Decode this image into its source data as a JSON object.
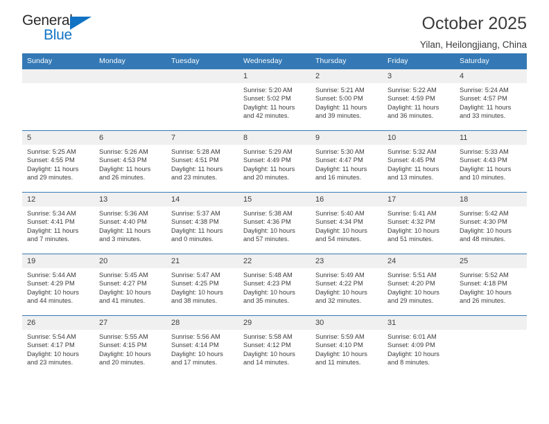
{
  "brand": {
    "name_part1": "General",
    "name_part2": "Blue",
    "accent_color": "#1273c4"
  },
  "header": {
    "title": "October 2025",
    "subtitle": "Yilan, Heilongjiang, China"
  },
  "theme": {
    "header_row_color": "#3479b5",
    "daynum_band_color": "#f0f0f0",
    "text_color": "#3b3b3b"
  },
  "calendar": {
    "weekday_headers": [
      "Sunday",
      "Monday",
      "Tuesday",
      "Wednesday",
      "Thursday",
      "Friday",
      "Saturday"
    ],
    "weeks": [
      [
        {
          "day": "",
          "empty": true
        },
        {
          "day": "",
          "empty": true
        },
        {
          "day": "",
          "empty": true
        },
        {
          "day": "1",
          "sunrise": "Sunrise: 5:20 AM",
          "sunset": "Sunset: 5:02 PM",
          "daylight": "Daylight: 11 hours and 42 minutes."
        },
        {
          "day": "2",
          "sunrise": "Sunrise: 5:21 AM",
          "sunset": "Sunset: 5:00 PM",
          "daylight": "Daylight: 11 hours and 39 minutes."
        },
        {
          "day": "3",
          "sunrise": "Sunrise: 5:22 AM",
          "sunset": "Sunset: 4:59 PM",
          "daylight": "Daylight: 11 hours and 36 minutes."
        },
        {
          "day": "4",
          "sunrise": "Sunrise: 5:24 AM",
          "sunset": "Sunset: 4:57 PM",
          "daylight": "Daylight: 11 hours and 33 minutes."
        }
      ],
      [
        {
          "day": "5",
          "sunrise": "Sunrise: 5:25 AM",
          "sunset": "Sunset: 4:55 PM",
          "daylight": "Daylight: 11 hours and 29 minutes."
        },
        {
          "day": "6",
          "sunrise": "Sunrise: 5:26 AM",
          "sunset": "Sunset: 4:53 PM",
          "daylight": "Daylight: 11 hours and 26 minutes."
        },
        {
          "day": "7",
          "sunrise": "Sunrise: 5:28 AM",
          "sunset": "Sunset: 4:51 PM",
          "daylight": "Daylight: 11 hours and 23 minutes."
        },
        {
          "day": "8",
          "sunrise": "Sunrise: 5:29 AM",
          "sunset": "Sunset: 4:49 PM",
          "daylight": "Daylight: 11 hours and 20 minutes."
        },
        {
          "day": "9",
          "sunrise": "Sunrise: 5:30 AM",
          "sunset": "Sunset: 4:47 PM",
          "daylight": "Daylight: 11 hours and 16 minutes."
        },
        {
          "day": "10",
          "sunrise": "Sunrise: 5:32 AM",
          "sunset": "Sunset: 4:45 PM",
          "daylight": "Daylight: 11 hours and 13 minutes."
        },
        {
          "day": "11",
          "sunrise": "Sunrise: 5:33 AM",
          "sunset": "Sunset: 4:43 PM",
          "daylight": "Daylight: 11 hours and 10 minutes."
        }
      ],
      [
        {
          "day": "12",
          "sunrise": "Sunrise: 5:34 AM",
          "sunset": "Sunset: 4:41 PM",
          "daylight": "Daylight: 11 hours and 7 minutes."
        },
        {
          "day": "13",
          "sunrise": "Sunrise: 5:36 AM",
          "sunset": "Sunset: 4:40 PM",
          "daylight": "Daylight: 11 hours and 3 minutes."
        },
        {
          "day": "14",
          "sunrise": "Sunrise: 5:37 AM",
          "sunset": "Sunset: 4:38 PM",
          "daylight": "Daylight: 11 hours and 0 minutes."
        },
        {
          "day": "15",
          "sunrise": "Sunrise: 5:38 AM",
          "sunset": "Sunset: 4:36 PM",
          "daylight": "Daylight: 10 hours and 57 minutes."
        },
        {
          "day": "16",
          "sunrise": "Sunrise: 5:40 AM",
          "sunset": "Sunset: 4:34 PM",
          "daylight": "Daylight: 10 hours and 54 minutes."
        },
        {
          "day": "17",
          "sunrise": "Sunrise: 5:41 AM",
          "sunset": "Sunset: 4:32 PM",
          "daylight": "Daylight: 10 hours and 51 minutes."
        },
        {
          "day": "18",
          "sunrise": "Sunrise: 5:42 AM",
          "sunset": "Sunset: 4:30 PM",
          "daylight": "Daylight: 10 hours and 48 minutes."
        }
      ],
      [
        {
          "day": "19",
          "sunrise": "Sunrise: 5:44 AM",
          "sunset": "Sunset: 4:29 PM",
          "daylight": "Daylight: 10 hours and 44 minutes."
        },
        {
          "day": "20",
          "sunrise": "Sunrise: 5:45 AM",
          "sunset": "Sunset: 4:27 PM",
          "daylight": "Daylight: 10 hours and 41 minutes."
        },
        {
          "day": "21",
          "sunrise": "Sunrise: 5:47 AM",
          "sunset": "Sunset: 4:25 PM",
          "daylight": "Daylight: 10 hours and 38 minutes."
        },
        {
          "day": "22",
          "sunrise": "Sunrise: 5:48 AM",
          "sunset": "Sunset: 4:23 PM",
          "daylight": "Daylight: 10 hours and 35 minutes."
        },
        {
          "day": "23",
          "sunrise": "Sunrise: 5:49 AM",
          "sunset": "Sunset: 4:22 PM",
          "daylight": "Daylight: 10 hours and 32 minutes."
        },
        {
          "day": "24",
          "sunrise": "Sunrise: 5:51 AM",
          "sunset": "Sunset: 4:20 PM",
          "daylight": "Daylight: 10 hours and 29 minutes."
        },
        {
          "day": "25",
          "sunrise": "Sunrise: 5:52 AM",
          "sunset": "Sunset: 4:18 PM",
          "daylight": "Daylight: 10 hours and 26 minutes."
        }
      ],
      [
        {
          "day": "26",
          "sunrise": "Sunrise: 5:54 AM",
          "sunset": "Sunset: 4:17 PM",
          "daylight": "Daylight: 10 hours and 23 minutes."
        },
        {
          "day": "27",
          "sunrise": "Sunrise: 5:55 AM",
          "sunset": "Sunset: 4:15 PM",
          "daylight": "Daylight: 10 hours and 20 minutes."
        },
        {
          "day": "28",
          "sunrise": "Sunrise: 5:56 AM",
          "sunset": "Sunset: 4:14 PM",
          "daylight": "Daylight: 10 hours and 17 minutes."
        },
        {
          "day": "29",
          "sunrise": "Sunrise: 5:58 AM",
          "sunset": "Sunset: 4:12 PM",
          "daylight": "Daylight: 10 hours and 14 minutes."
        },
        {
          "day": "30",
          "sunrise": "Sunrise: 5:59 AM",
          "sunset": "Sunset: 4:10 PM",
          "daylight": "Daylight: 10 hours and 11 minutes."
        },
        {
          "day": "31",
          "sunrise": "Sunrise: 6:01 AM",
          "sunset": "Sunset: 4:09 PM",
          "daylight": "Daylight: 10 hours and 8 minutes."
        },
        {
          "day": "",
          "empty": true
        }
      ]
    ]
  }
}
